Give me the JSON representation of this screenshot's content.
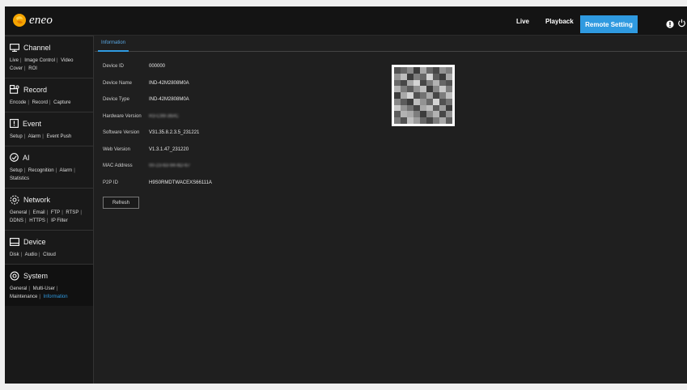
{
  "logo": {
    "text": "eneo"
  },
  "topnav": {
    "live": "Live",
    "playback": "Playback",
    "remote_setting": "Remote Setting"
  },
  "sidebar": [
    {
      "id": "channel",
      "title": "Channel",
      "icon": "monitor-icon",
      "links": [
        "Live",
        "Image Control",
        "Video Cover",
        "ROI"
      ]
    },
    {
      "id": "record",
      "title": "Record",
      "icon": "record-icon",
      "links": [
        "Encode",
        "Record",
        "Capture"
      ]
    },
    {
      "id": "event",
      "title": "Event",
      "icon": "event-icon",
      "links": [
        "Setup",
        "Alarm",
        "Event Push"
      ]
    },
    {
      "id": "ai",
      "title": "AI",
      "icon": "ai-icon",
      "links": [
        "Setup",
        "Recognition",
        "Alarm",
        "Statistics"
      ]
    },
    {
      "id": "network",
      "title": "Network",
      "icon": "network-icon",
      "links": [
        "General",
        "Email",
        "FTP",
        "RTSP",
        "DDNS",
        "HTTPS",
        "IP Filter"
      ]
    },
    {
      "id": "device",
      "title": "Device",
      "icon": "device-icon",
      "links": [
        "Disk",
        "Audio",
        "Cloud"
      ]
    },
    {
      "id": "system",
      "title": "System",
      "icon": "system-icon",
      "links": [
        "General",
        "Multi-User",
        "Maintenance",
        "Information"
      ],
      "active_link": "Information"
    }
  ],
  "main": {
    "tab": "Information",
    "rows": [
      {
        "label": "Device ID",
        "value": "000000"
      },
      {
        "label": "Device Name",
        "value": "IND-42M2808M0A"
      },
      {
        "label": "Device Type",
        "value": "IND-42M2808M0A"
      },
      {
        "label": "Hardware Version",
        "value": "R3-C99-36#C",
        "blurred": true
      },
      {
        "label": "Software Version",
        "value": "V31.35.8.2.3.5_231221"
      },
      {
        "label": "Web Version",
        "value": "V1.3.1.47_231220"
      },
      {
        "label": "MAC Address",
        "value": "00-23-63-94-6D-67",
        "blurred": true
      },
      {
        "label": "P2P ID",
        "value": "H9S0RMDTWACEXS66111A"
      }
    ],
    "refresh_label": "Refresh"
  },
  "qr": {
    "cells": [
      0.8,
      0.7,
      0.55,
      0.9,
      0.4,
      0.7,
      0.85,
      0.5,
      0.6,
      0.5,
      0.3,
      0.9,
      0.6,
      0.7,
      0.2,
      0.75,
      0.9,
      0.4,
      0.7,
      0.85,
      0.4,
      0.2,
      0.85,
      0.6,
      0.35,
      0.7,
      0.8,
      0.35,
      0.6,
      0.75,
      0.5,
      0.3,
      0.9,
      0.55,
      0.25,
      0.6,
      0.9,
      0.4,
      0.2,
      0.8,
      0.65,
      0.4,
      0.85,
      0.6,
      0.3,
      0.55,
      0.75,
      0.9,
      0.3,
      0.5,
      0.7,
      0.2,
      0.8,
      0.65,
      0.25,
      0.5,
      0.65,
      0.85,
      0.4,
      0.3,
      0.75,
      0.45,
      0.9,
      0.75,
      0.35,
      0.4,
      0.6,
      0.9,
      0.55,
      0.35,
      0.85,
      0.5,
      0.6,
      0.8,
      0.3,
      0.45,
      0.7,
      0.85,
      0.6,
      0.4,
      0.75
    ]
  }
}
